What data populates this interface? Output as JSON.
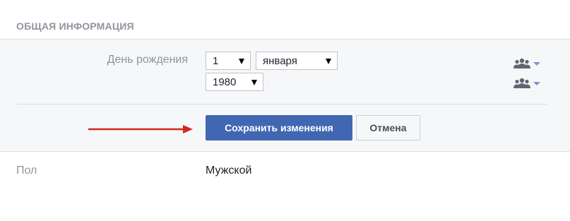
{
  "section": {
    "title": "ОБЩАЯ ИНФОРМАЦИЯ"
  },
  "birthday": {
    "label": "День рождения",
    "day": "1",
    "month": "января",
    "year": "1980"
  },
  "audience": {
    "icon": "friends-audience-icon",
    "accent": "#7f95c3"
  },
  "actions": {
    "save_label": "Сохранить изменения",
    "cancel_label": "Отмена"
  },
  "gender": {
    "label": "Пол",
    "value": "Мужской"
  },
  "colors": {
    "primary_button": "#4267b2",
    "annotation_arrow": "#d0281c",
    "panel_background": "#f6f7f9"
  }
}
